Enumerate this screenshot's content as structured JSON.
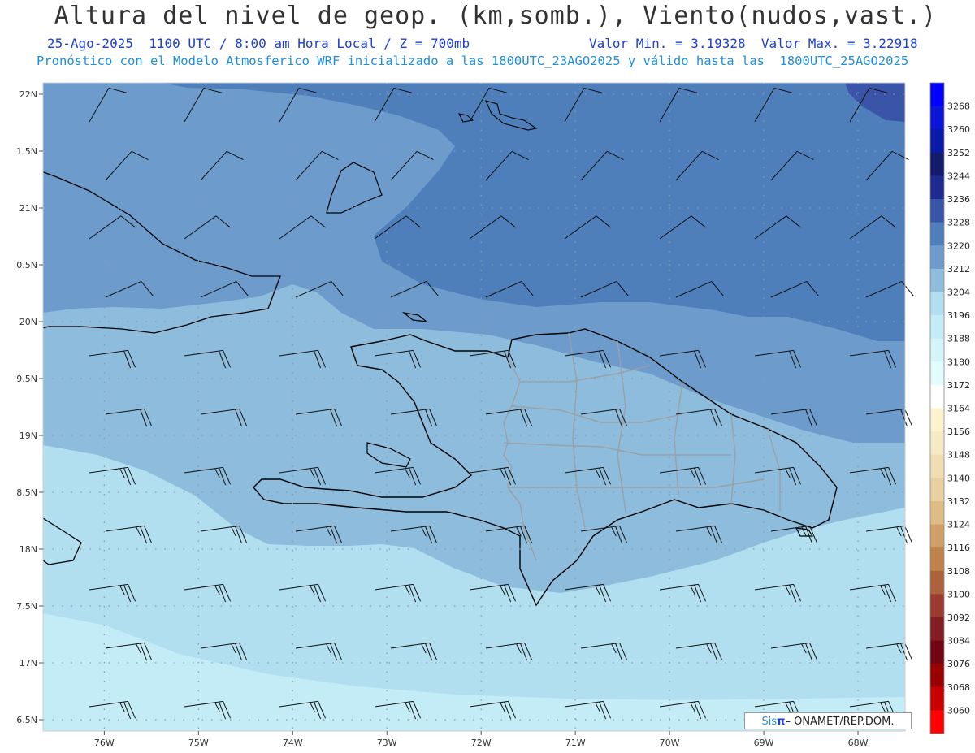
{
  "header": {
    "title": "Altura del nivel de geop. (km,somb.), Viento(nudos,vast.)",
    "subtitle_left": "25-Ago-2025  1100 UTC / 8:00 am Hora Local / Z = 700mb",
    "subtitle_right": "Valor Min. = 3.19328  Valor Max. = 3.22918",
    "model_line": "Pronóstico con el Modelo Atmosferico WRF inicializado a las 1800UTC_23AGO2025 y válido hasta las  1800UTC_25AGO2025"
  },
  "map": {
    "lon_range": [
      -76.65,
      -67.5
    ],
    "lat_range": [
      16.4,
      22.1
    ],
    "lat_ticks": [
      {
        "v": 22.0,
        "label": "22N"
      },
      {
        "v": 21.5,
        "label": "1.5N"
      },
      {
        "v": 21.0,
        "label": "21N"
      },
      {
        "v": 20.5,
        "label": "0.5N"
      },
      {
        "v": 20.0,
        "label": "20N"
      },
      {
        "v": 19.5,
        "label": "9.5N"
      },
      {
        "v": 19.0,
        "label": "19N"
      },
      {
        "v": 18.5,
        "label": "8.5N"
      },
      {
        "v": 18.0,
        "label": "18N"
      },
      {
        "v": 17.5,
        "label": "7.5N"
      },
      {
        "v": 17.0,
        "label": "17N"
      },
      {
        "v": 16.5,
        "label": "6.5N"
      }
    ],
    "lon_ticks": [
      {
        "v": -76,
        "label": "76W"
      },
      {
        "v": -75,
        "label": "75W"
      },
      {
        "v": -74,
        "label": "74W"
      },
      {
        "v": -73,
        "label": "73W"
      },
      {
        "v": -72,
        "label": "72W"
      },
      {
        "v": -71,
        "label": "71W"
      },
      {
        "v": -70,
        "label": "70W"
      },
      {
        "v": -69,
        "label": "69W"
      },
      {
        "v": -68,
        "label": "68W"
      }
    ],
    "grid_lines": true
  },
  "colorbar": {
    "levels": [
      3268,
      3260,
      3252,
      3244,
      3236,
      3228,
      3220,
      3212,
      3204,
      3196,
      3188,
      3180,
      3172,
      3164,
      3156,
      3148,
      3140,
      3132,
      3124,
      3116,
      3108,
      3100,
      3092,
      3084,
      3076,
      3068,
      3060
    ],
    "colors": [
      "#0000ff",
      "#0c14d8",
      "#0a1aa8",
      "#121b6e",
      "#1e2a8f",
      "#3a55a8",
      "#4f7fbb",
      "#6d9ccc",
      "#8ebcdc",
      "#b2dff0",
      "#c4ecf7",
      "#d4f4fa",
      "#e2fbfd",
      "#ffffff",
      "#fbf3cd",
      "#f6eac2",
      "#f0deb2",
      "#ead09e",
      "#e0bc85",
      "#d09f66",
      "#c0824b",
      "#ad623c",
      "#9b3b30",
      "#841c24",
      "#720414",
      "#9a0000",
      "#c80000",
      "#ff0000"
    ]
  },
  "credit": {
    "sis": "Sis",
    "pi": "π",
    "rest": "– ONAMET/REP.DOM."
  }
}
